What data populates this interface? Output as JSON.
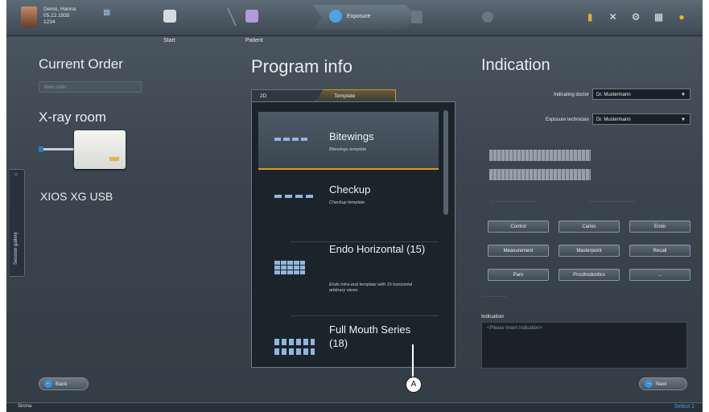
{
  "topbar": {
    "patient": {
      "name": "Demo, Hanna",
      "dob": "05.12.1935",
      "id": "1234"
    },
    "crumbs": [
      {
        "label": "Start",
        "active": false
      },
      {
        "label": "Patient",
        "active": false
      },
      {
        "label": "Exposure",
        "active": true
      }
    ]
  },
  "left": {
    "current_order_title": "Current Order",
    "order_placeholder": "New order",
    "room_title": "X-ray room",
    "device_name": "XIOS XG USB",
    "gallery_tab": "Session gallery",
    "back_label": "Back"
  },
  "program": {
    "title": "Program info",
    "tabs": [
      "2D",
      "Template"
    ],
    "templates": [
      {
        "name": "Bitewings",
        "desc": "Bitewings template"
      },
      {
        "name": "Checkup",
        "desc": "Checkup template"
      },
      {
        "name": "Endo Horizontal (15)",
        "desc": "Endo intra-oral template with 15 horizontal arbitrary views"
      },
      {
        "name": "Full Mouth Series (18)",
        "desc": ""
      }
    ]
  },
  "indication": {
    "title": "Indication",
    "doctor_label": "Indicating doctor",
    "doctor_value": "Dr. Mustermann",
    "tech_label": "Exposure technician",
    "tech_value": "Dr. Mustermann",
    "buttons": [
      "Control",
      "Caries",
      "Endo",
      "Measurement",
      "Masterpoint",
      "Recall",
      "Paro",
      "Prosthodontics",
      "..."
    ],
    "indication_label": "Indication",
    "indication_placeholder": "<Please insert indication>",
    "next_label": "Next"
  },
  "callout": "A",
  "footer": {
    "brand": "Sirona",
    "selection": "Select 1"
  }
}
